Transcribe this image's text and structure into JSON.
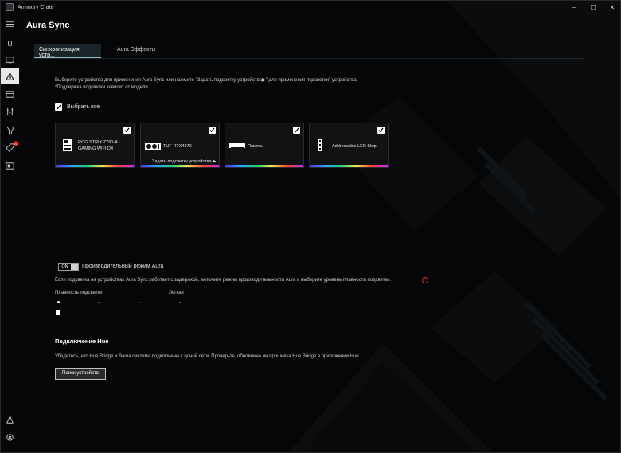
{
  "app": {
    "title": "Armoury Crate",
    "window_controls": {
      "minimize": "─",
      "maximize": "☐",
      "close": "✕"
    }
  },
  "sidebar": {
    "items": [
      {
        "icon": "menu-icon"
      },
      {
        "icon": "home-icon"
      },
      {
        "icon": "device-icon"
      },
      {
        "icon": "aura-sync-icon",
        "active": true
      },
      {
        "icon": "gamevisual-icon"
      },
      {
        "icon": "tools-icon"
      },
      {
        "icon": "wrench-screwdriver-icon"
      },
      {
        "icon": "deals-tag-icon",
        "badge": "10"
      },
      {
        "icon": "news-icon"
      }
    ],
    "bottom": [
      {
        "icon": "user-account-icon"
      },
      {
        "icon": "settings-gear-icon"
      }
    ]
  },
  "page": {
    "title": "Aura Sync",
    "tabs": [
      {
        "label": "Синхронизация устр...",
        "active": true
      },
      {
        "label": "Aura Эффекты",
        "active": false
      }
    ]
  },
  "sync": {
    "instruction_line1": "Выберите устройства для применения Aura Sync или нажмите \"Задать подсветку устройства▶\" для применения подсветки\" устройства.",
    "instruction_line2": "*Поддержка подсветки зависит от модели.",
    "select_all_label": "Выбрать все",
    "select_all_checked": true,
    "devices": [
      {
        "name_line1": "ROG STRIX Z790-A",
        "name_line2": "GAMING WIFI D4",
        "icon": "motherboard-icon",
        "checked": true
      },
      {
        "name_line1": "TUF-RTX4070",
        "name_line2": "",
        "icon": "graphics-card-icon",
        "checked": true,
        "link": "Задать подсветку устройства ▶"
      },
      {
        "name_line1": "Память",
        "name_line2": "",
        "icon": "memory-icon",
        "checked": true
      },
      {
        "name_line1": "Addressable LED Strip",
        "name_line2": "",
        "icon": "led-strip-icon",
        "checked": true
      }
    ]
  },
  "performance": {
    "toggle_state": "ON",
    "toggle_label": "Производительный режим Aura",
    "description": "Если подсветка на устройствах Aura Sync работает с задержкой, включите режим производительности Aura и выберите уровень плавности подсветки.",
    "slider_label_left": "Плавность подсветки",
    "slider_label_right": "Легкая",
    "slider_level": 0
  },
  "hue": {
    "title": "Подключение Hue",
    "description": "Убедитесь, что Hue Bridge и Ваша система подключены к одной сети. Проверьте, обновлена ли прошивка Hue Bridge в приложении Hue.",
    "search_button": "Поиск устройств"
  },
  "colors": {
    "background": "#050607",
    "accent_red": "#e0252a",
    "active_tab": "#8fb6c4"
  }
}
